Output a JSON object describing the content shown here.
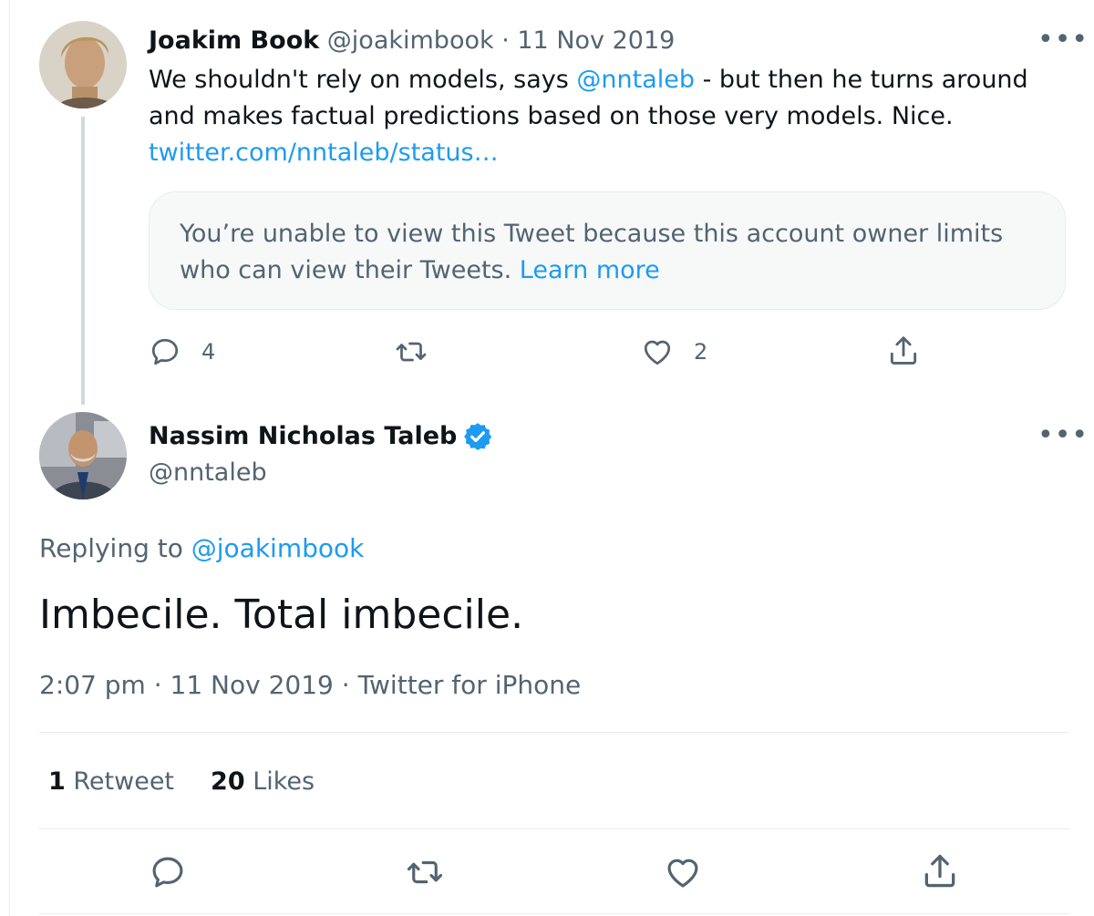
{
  "tweet1": {
    "display_name": "Joakim Book",
    "handle": "@joakimbook",
    "separator": " · ",
    "date": "11 Nov 2019",
    "more": "•••",
    "body_part1": "We shouldn't rely on models, says ",
    "mention": "@nntaleb",
    "body_part2": " - but then he turns around and makes factual predictions based on those very models. Nice.",
    "link": "twitter.com/nntaleb/status…",
    "quote_notice": "You’re unable to view this Tweet because this account owner limits who can view their Tweets. ",
    "quote_learn_more": "Learn more",
    "actions": {
      "reply_count": "4",
      "like_count": "2"
    }
  },
  "tweet2": {
    "display_name": "Nassim Nicholas Taleb",
    "handle": "@nntaleb",
    "more": "•••",
    "replying_prefix": "Replying to ",
    "replying_to": "@joakimbook",
    "text": "Imbecile. Total imbecile.",
    "meta": "2:07 pm · 11 Nov 2019 · Twitter for iPhone",
    "retweet_count": "1",
    "retweet_label": " Retweet",
    "like_count": "20",
    "like_label": " Likes"
  },
  "colors": {
    "link": "#1d9bf0",
    "muted": "#536471",
    "verified": "#1d9bf0",
    "divider": "#e6ecf0"
  },
  "icons": [
    "reply-icon",
    "retweet-icon",
    "like-icon",
    "share-icon",
    "verified-badge-icon",
    "more-icon"
  ]
}
